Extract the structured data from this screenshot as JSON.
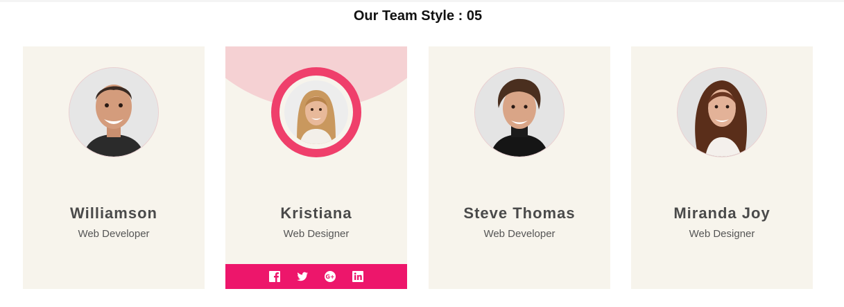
{
  "page": {
    "title": "Our Team Style : 05"
  },
  "colors": {
    "card_bg": "#f7f4ec",
    "accent_ring": "#ef3f6b",
    "accent_arc": "#f5d1d3",
    "social_bar": "#ed166b",
    "name_text": "#4a4a4a"
  },
  "members": [
    {
      "name": "Williamson",
      "role": "Web Developer"
    },
    {
      "name": "Kristiana",
      "role": "Web Designer",
      "active": true,
      "social": [
        "facebook-icon",
        "twitter-icon",
        "google-plus-icon",
        "linkedin-icon"
      ]
    },
    {
      "name": "Steve Thomas",
      "role": "Web Developer"
    },
    {
      "name": "Miranda Joy",
      "role": "Web Designer"
    }
  ]
}
